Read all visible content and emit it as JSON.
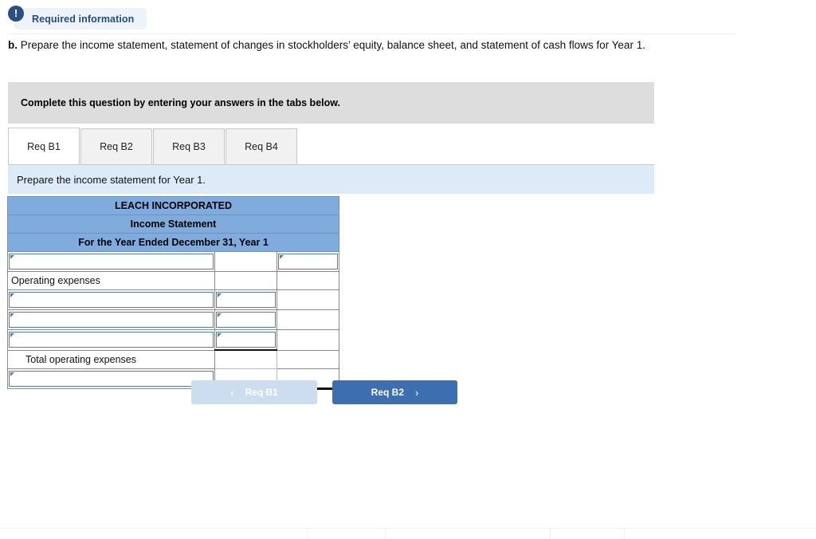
{
  "badge": {
    "icon": "exclamation-icon",
    "icon_glyph": "!",
    "label": "Required information"
  },
  "prompt": {
    "marker": "b.",
    "text": " Prepare the income statement, statement of changes in stockholders’ equity, balance sheet, and statement of cash flows for Year 1."
  },
  "instruction_bar": {
    "text": "Complete this question by entering your answers in the tabs below."
  },
  "tabs": [
    {
      "label": "Req B1",
      "active": true
    },
    {
      "label": "Req B2",
      "active": false
    },
    {
      "label": "Req B3",
      "active": false
    },
    {
      "label": "Req B4",
      "active": false
    }
  ],
  "sub_instruction": {
    "text": "Prepare the income statement for Year 1."
  },
  "statement": {
    "header": [
      "LEACH INCORPORATED",
      "Income Statement",
      "For the Year Ended December 31, Year 1"
    ],
    "rows": [
      {
        "label": "",
        "label_editable": true,
        "mid": "",
        "mid_editable": false,
        "right": "",
        "right_editable": true
      },
      {
        "label": "Operating expenses",
        "label_editable": false,
        "mid": "",
        "mid_editable": false,
        "right": "",
        "right_editable": false
      },
      {
        "label": "",
        "label_editable": true,
        "mid": "",
        "mid_editable": true,
        "right": "",
        "right_editable": false
      },
      {
        "label": "",
        "label_editable": true,
        "mid": "",
        "mid_editable": true,
        "right": "",
        "right_editable": false
      },
      {
        "label": "",
        "label_editable": true,
        "mid": "",
        "mid_editable": true,
        "right": "",
        "right_editable": false
      },
      {
        "label": "Total operating expenses",
        "label_editable": false,
        "indent": true,
        "mid": "",
        "mid_editable": false,
        "right": "",
        "right_editable": false
      },
      {
        "label": "",
        "label_editable": true,
        "mid": "",
        "mid_editable": false,
        "right": "",
        "right_editable": false
      }
    ]
  },
  "nav": {
    "prev": {
      "label": "Req B1",
      "chevron": "chevron-left-icon",
      "chevron_glyph": "‹",
      "disabled": true
    },
    "next": {
      "label": "Req B2",
      "chevron": "chevron-right-icon",
      "chevron_glyph": "›",
      "disabled": false
    }
  },
  "colors": {
    "badge_bg": "#eef3fa",
    "badge_text": "#1f4e85",
    "badge_icon_bg": "#2a4f82",
    "instruction_bar_bg": "#dddddd",
    "sub_instruction_bg": "#dcebf7",
    "table_header_bg": "#7fabdd",
    "input_border": "#4f7cb5",
    "button_primary": "#3d6eb0",
    "button_disabled": "#cdddf0"
  }
}
